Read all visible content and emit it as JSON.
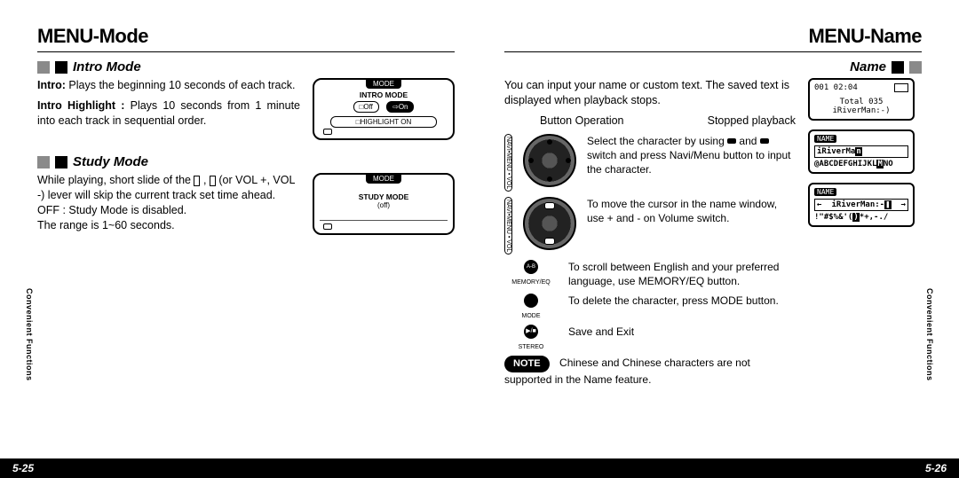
{
  "left": {
    "title": "MENU-Mode",
    "sideTab": "Convenient Functions",
    "pageNum": "5-25",
    "intro": {
      "header": "Intro Mode",
      "p1a": "Intro:",
      "p1b": " Plays the beginning 10 seconds of each track.",
      "p2a": "Intro Highlight :",
      "p2b": " Plays 10 seconds from 1 minute into each track in sequential order.",
      "lcd": {
        "top": "MODE",
        "title": "INTRO MODE",
        "opt1": "Off",
        "opt2": "On",
        "opt3": "HIGHLIGHT ON"
      }
    },
    "study": {
      "header": "Study  Mode",
      "p1": "While playing, short slide of the ",
      "p1b": " (or VOL +, VOL -) lever will skip the current track set time ahead.",
      "p2": "OFF : Study Mode is disabled.",
      "p3": "The range is 1~60 seconds.",
      "lcd": {
        "top": "MODE",
        "title": "STUDY MODE",
        "val": "(off)"
      }
    }
  },
  "right": {
    "title": "MENU-Name",
    "sideTab": "Convenient Functions",
    "pageNum": "5-26",
    "name": {
      "header": "Name",
      "p1": "You can input your name or custom text. The saved text is displayed when playback stops.",
      "opLabel": "Button Operation",
      "stateLabel": "Stopped playback",
      "step1": "Select the character by using ",
      "step1b": " and ",
      "step1c": " switch and press Navi/Menu button to input the character.",
      "step2": "To move the cursor in the name window, use + and - on Volume switch.",
      "step3": "To scroll between English and your preferred language, use MEMORY/EQ button.",
      "step4": "To delete the character, press MODE button.",
      "step5": "Save and Exit",
      "btn1": "A-B",
      "btn1l": "MEMORY/EQ",
      "btn2l": "MODE",
      "btn3l": "STEREO",
      "noteLabel": "NOTE",
      "noteText": "Chinese and Chinese characters are not supported in the Name feature."
    },
    "lcd1": {
      "time": "001 02:04",
      "total": "Total 035",
      "name": "iRiverMan:-)"
    },
    "lcd2": {
      "tag": "NAME",
      "val": "iRiverMa",
      "cursor": "n",
      "row": "@ABCDEFGHIJKL",
      "sel": "M",
      "suf": "NO"
    },
    "lcd3": {
      "tag": "NAME",
      "val": "iRiverMan:-",
      "cursor": "❚",
      "row": "!\"#$%&'(",
      "sel": ")",
      "suf": "*+,-./"
    }
  }
}
